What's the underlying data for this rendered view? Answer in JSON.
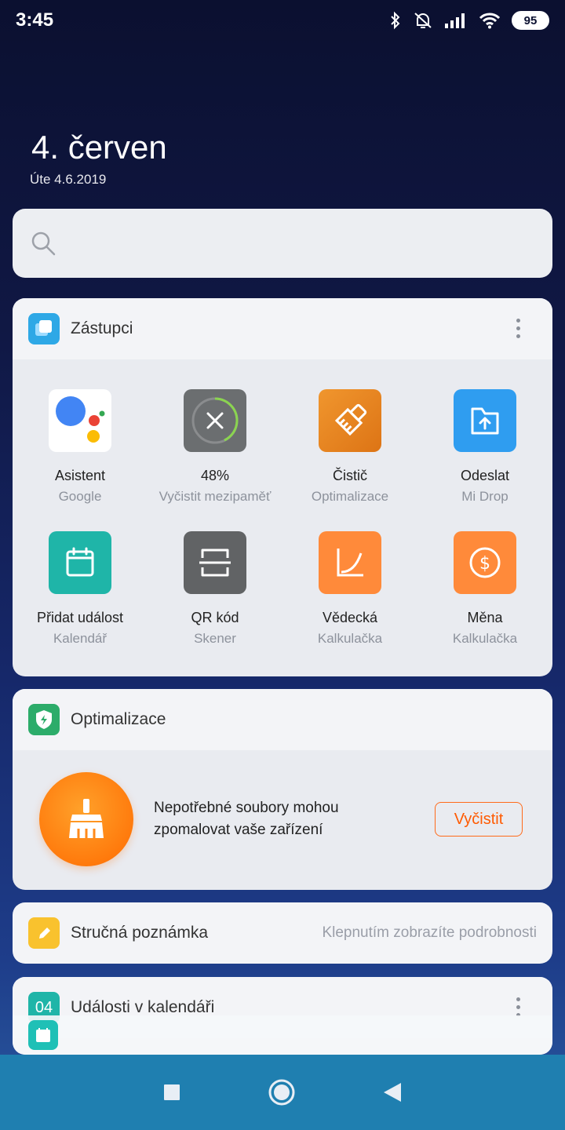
{
  "status": {
    "time": "3:45",
    "battery": "95",
    "icons": [
      "bluetooth-icon",
      "alarm-off-icon",
      "signal-icon",
      "wifi-icon",
      "battery-icon"
    ]
  },
  "header": {
    "date_big": "4. červen",
    "date_small": "Úte 4.6.2019"
  },
  "search": {
    "placeholder": ""
  },
  "shortcuts": {
    "title": "Zástupci",
    "items": [
      {
        "name": "Asistent",
        "sub": "Google",
        "icon": "google-assistant-icon"
      },
      {
        "name": "48%",
        "sub": "Vyčistit mezipaměť",
        "icon": "memory-clean-icon"
      },
      {
        "name": "Čistič",
        "sub": "Optimalizace",
        "icon": "cleaner-icon"
      },
      {
        "name": "Odeslat",
        "sub": "Mi Drop",
        "icon": "mi-drop-icon"
      },
      {
        "name": "Přidat událost",
        "sub": "Kalendář",
        "icon": "calendar-add-icon"
      },
      {
        "name": "QR kód",
        "sub": "Skener",
        "icon": "qr-scanner-icon"
      },
      {
        "name": "Vědecká",
        "sub": "Kalkulačka",
        "icon": "scientific-calculator-icon"
      },
      {
        "name": "Měna",
        "sub": "Kalkulačka",
        "icon": "currency-calculator-icon"
      }
    ]
  },
  "optimization": {
    "title": "Optimalizace",
    "message": "Nepotřebné soubory mohou zpomalovat vaše zařízení",
    "button": "Vyčistit"
  },
  "note": {
    "title": "Stručná poznámka",
    "hint": "Klepnutím zobrazíte podrobnosti"
  },
  "calendar": {
    "title": "Události v kalendáři",
    "day": "04"
  },
  "colors": {
    "accent_orange": "#ff6a00",
    "shortcut_blue": "#2ea8e6",
    "teal": "#1fb5a8",
    "nav_blue": "#1f7fb0"
  }
}
